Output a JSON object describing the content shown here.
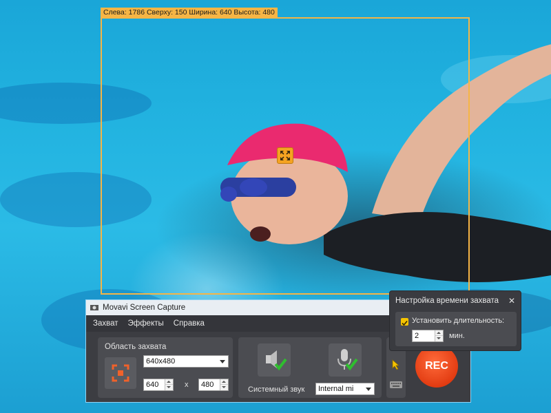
{
  "capture": {
    "label": "Слева: 1786  Сверху: 150  Ширина: 640  Высота: 480"
  },
  "window": {
    "title": "Movavi Screen Capture",
    "menu": [
      "Захват",
      "Эффекты",
      "Справка"
    ]
  },
  "area": {
    "title": "Область захвата",
    "preset": "640x480",
    "width": "640",
    "height": "480",
    "times": "x"
  },
  "audio": {
    "system_label": "Системный звук",
    "mic_device": "Internal mi"
  },
  "rec_label": "REC",
  "popup": {
    "title": "Настройка времени захвата",
    "checkbox_label": "Установить длительность:",
    "duration_value": "2",
    "unit": "мин."
  },
  "colors": {
    "accent": "#f6b545",
    "rec": "#e23c12",
    "panel": "#4b4c51",
    "window": "#3c3d42"
  }
}
